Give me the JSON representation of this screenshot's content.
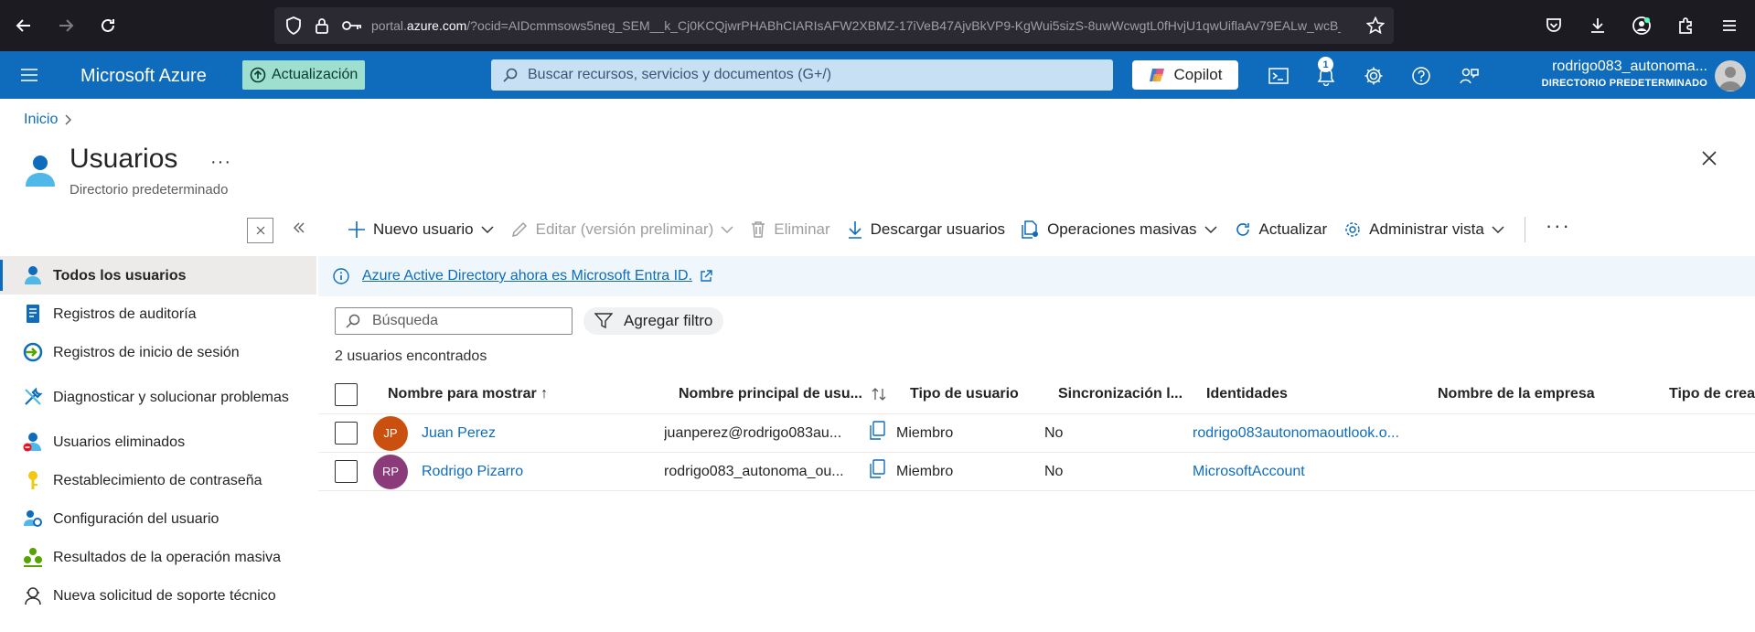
{
  "browser": {
    "url_prefix": "portal.",
    "url_domain": "azure.com",
    "url_rest": "/?ocid=AIDcmmsows5neg_SEM__k_Cj0KCQjwrPHABhCIARIsAFW2XBMZ-17iVeB47AjvBkVP9-KgWui5sizS-8uwWcwgtL0fHvjU1qwUiflaAv79EALw_wcB_k_&icid=f"
  },
  "topbar": {
    "brand": "Microsoft Azure",
    "update_label": "Actualización",
    "search_placeholder": "Buscar recursos, servicios y documentos (G+/)",
    "copilot_label": "Copilot",
    "notifications_count": "1",
    "account_name": "rodrigo083_autonoma...",
    "account_directory": "DIRECTORIO PREDETERMINADO"
  },
  "breadcrumb": {
    "home": "Inicio"
  },
  "page": {
    "title": "Usuarios",
    "more": "···",
    "subtitle": "Directorio predeterminado"
  },
  "sidebar": {
    "items": [
      {
        "label": "Todos los usuarios",
        "icon": "user-icon"
      },
      {
        "label": "Registros de auditoría",
        "icon": "audit-log-icon"
      },
      {
        "label": "Registros de inicio de sesión",
        "icon": "signin-log-icon"
      },
      {
        "label": "Diagnosticar y solucionar problemas",
        "icon": "wrench-icon"
      },
      {
        "label": "Usuarios eliminados",
        "icon": "deleted-user-icon"
      },
      {
        "label": "Restablecimiento de contraseña",
        "icon": "key-icon"
      },
      {
        "label": "Configuración del usuario",
        "icon": "user-settings-icon"
      },
      {
        "label": "Resultados de la operación masiva",
        "icon": "bulk-results-icon"
      },
      {
        "label": "Nueva solicitud de soporte técnico",
        "icon": "support-icon"
      }
    ]
  },
  "toolbar": {
    "new_user": "Nuevo usuario",
    "edit": "Editar (versión preliminar)",
    "delete": "Eliminar",
    "download": "Descargar usuarios",
    "bulk": "Operaciones masivas",
    "refresh": "Actualizar",
    "manage_view": "Administrar vista",
    "more": "···"
  },
  "banner": {
    "text": "Azure Active Directory ahora es Microsoft Entra ID."
  },
  "list": {
    "search_placeholder": "Búsqueda",
    "filter_label": "Agregar filtro",
    "count_text": "2 usuarios encontrados"
  },
  "table": {
    "headers": {
      "display_name": "Nombre para mostrar ↑",
      "upn": "Nombre principal de usu...",
      "user_type": "Tipo de usuario",
      "sync": "Sincronización l...",
      "identities": "Identidades",
      "company": "Nombre de la empresa",
      "creation_type": "Tipo de creación"
    },
    "rows": [
      {
        "initials": "JP",
        "avatar_color": "#ca5010",
        "name": "Juan Perez",
        "upn": "juanperez@rodrigo083au...",
        "type": "Miembro",
        "sync": "No",
        "identity": "rodrigo083autonomaoutlook.o..."
      },
      {
        "initials": "RP",
        "avatar_color": "#8b3a7a",
        "name": "Rodrigo Pizarro",
        "upn": "rodrigo083_autonoma_ou...",
        "type": "Miembro",
        "sync": "No",
        "identity": "MicrosoftAccount"
      }
    ]
  },
  "colors": {
    "azure_blue": "#0f6cbd",
    "browser_dark": "#1c1b22",
    "update_green": "#9fdfcf"
  }
}
